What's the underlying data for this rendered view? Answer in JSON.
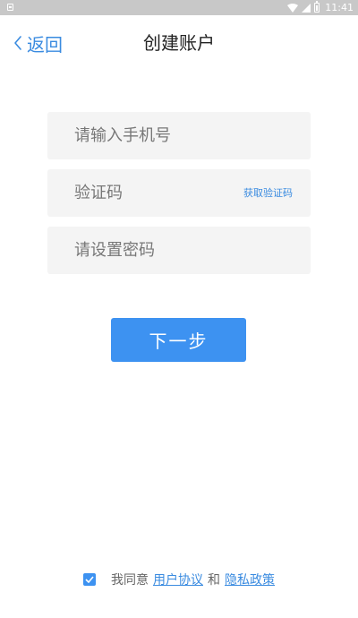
{
  "status_bar": {
    "time": "11:41"
  },
  "nav": {
    "back_label": "返回",
    "title": "创建账户"
  },
  "form": {
    "phone_placeholder": "请输入手机号",
    "code_placeholder": "验证码",
    "get_code_label": "获取验证码",
    "password_placeholder": "请设置密码"
  },
  "actions": {
    "next_label": "下一步"
  },
  "agreement": {
    "checked": true,
    "prefix": "我同意",
    "user_agreement": "用户协议",
    "conjunction": "和",
    "privacy_policy": "隐私政策"
  },
  "colors": {
    "accent": "#3d92f1",
    "link": "#3a8be0",
    "status_bar": "#c8c8c8",
    "field_bg": "#f4f4f4"
  }
}
